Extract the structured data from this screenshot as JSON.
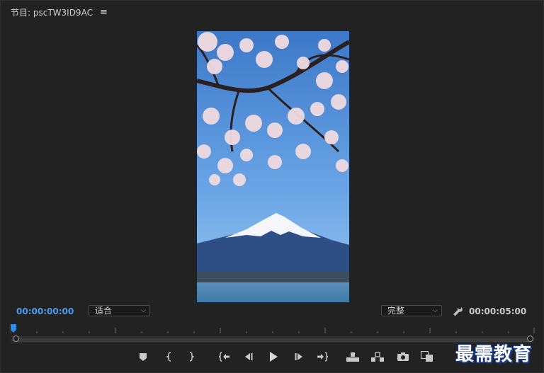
{
  "header": {
    "title": "节目: pscTW3ID9AC",
    "menu_icon": "hamburger-menu-icon"
  },
  "preview": {
    "description_icon": "video-frame"
  },
  "timecodes": {
    "current": "00:00:00:00",
    "duration": "00:00:05:00"
  },
  "fit_select": {
    "value": "适合"
  },
  "quality_select": {
    "value": "完整"
  },
  "controls": {
    "buttons": [
      "add-marker-icon",
      "mark-in-icon",
      "mark-out-icon",
      "go-to-in-icon",
      "step-back-icon",
      "play-icon",
      "step-forward-icon",
      "go-to-out-icon",
      "lift-icon",
      "extract-icon",
      "export-frame-icon",
      "comparison-view-icon"
    ]
  },
  "watermark": {
    "text": "最需教育"
  },
  "colors": {
    "timecode_accent": "#4b9cf0",
    "panel_bg": "#222222"
  }
}
